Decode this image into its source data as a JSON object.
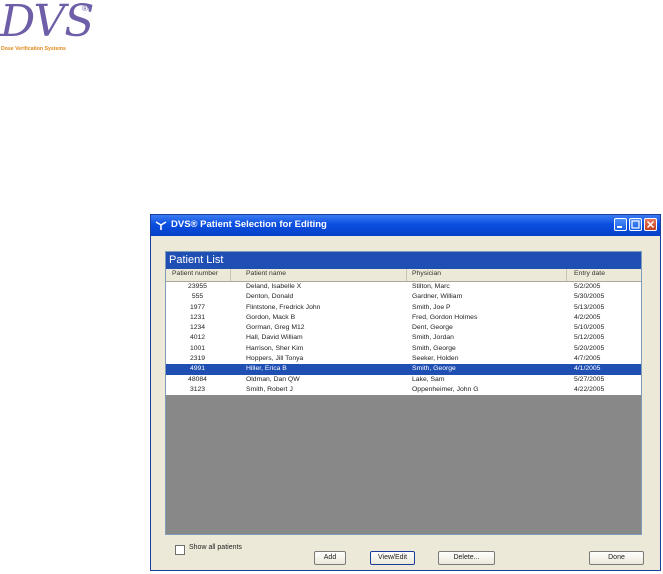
{
  "logo": {
    "text": "DVS",
    "reg": "®",
    "subtitle": "Dose Verification Systems"
  },
  "window": {
    "title": "DVS® Patient Selection for Editing",
    "panel_title": "Patient List",
    "columns": [
      "Patient number",
      "Patient name",
      "Physician",
      "Entry date"
    ],
    "rows": [
      [
        "23955",
        "Deland, Isabelle X",
        "Stilton, Marc",
        "5/2/2005"
      ],
      [
        "555",
        "Denton, Donald",
        "Gardner, William",
        "5/30/2005"
      ],
      [
        "1977",
        "Flintstone, Fredrick John",
        "Smith, Joe P",
        "5/13/2005"
      ],
      [
        "1231",
        "Gordon, Mack B",
        "Fred, Gordon Holmes",
        "4/2/2005"
      ],
      [
        "1234",
        "Gorman, Greg M12",
        "Dent, George",
        "5/10/2005"
      ],
      [
        "4012",
        "Hall, David William",
        "Smith, Jordan",
        "5/12/2005"
      ],
      [
        "1001",
        "Harrison, Sher Kim",
        "Smith, George",
        "5/20/2005"
      ],
      [
        "2319",
        "Hoppers, Jill Tonya",
        "Seeker, Holden",
        "4/7/2005"
      ],
      [
        "4991",
        "Hiller, Erica B",
        "Smith, George",
        "4/1/2005"
      ],
      [
        "48084",
        "Oldman, Dan QW",
        "Lake, Sam",
        "5/27/2005"
      ],
      [
        "3123",
        "Smith, Robert J",
        "Oppenheimer, John G",
        "4/22/2005"
      ]
    ],
    "selected_row": 8,
    "show_all_label": "Show all patients",
    "buttons": {
      "add": "Add",
      "view_edit": "View/Edit",
      "delete": "Delete...",
      "done": "Done"
    }
  },
  "colors": {
    "titlebar": "#0a4ee0",
    "selection": "#1f4fb3",
    "logo": "#6e5ea8",
    "logo_sub": "#e08a1e"
  }
}
